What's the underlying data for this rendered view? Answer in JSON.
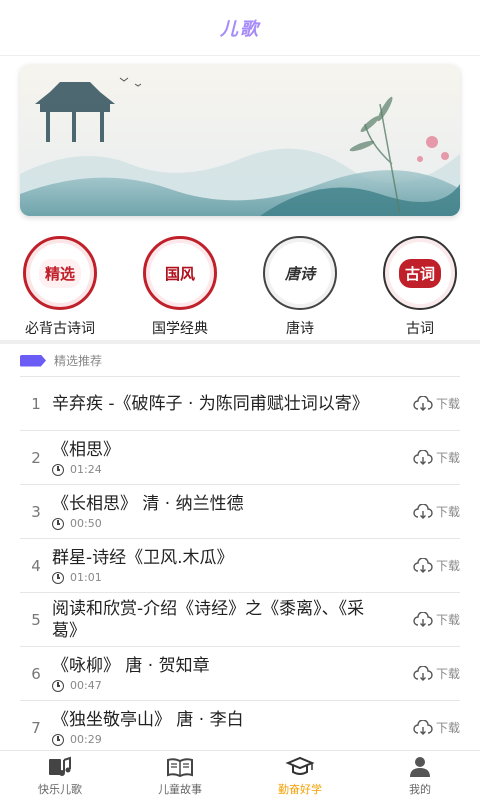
{
  "header": {
    "title": "儿歌"
  },
  "categories": [
    {
      "badge": "精选",
      "label": "必背古诗词"
    },
    {
      "badge": "国风",
      "label": "国学经典"
    },
    {
      "badge": "唐诗",
      "label": "唐诗"
    },
    {
      "badge": "古词",
      "label": "古词"
    }
  ],
  "section": {
    "title": "精选推荐"
  },
  "items": [
    {
      "num": "1",
      "name": " 辛弃疾 -《破阵子 · 为陈同甫赋壮词以寄》",
      "duration": "",
      "download": "下载"
    },
    {
      "num": "2",
      "name": "《相思》",
      "duration": "01:24",
      "download": "下载"
    },
    {
      "num": "3",
      "name": "《长相思》 清 · 纳兰性德",
      "duration": "00:50",
      "download": "下载"
    },
    {
      "num": "4",
      "name": "群星-诗经《卫风.木瓜》",
      "duration": "01:01",
      "download": "下载"
    },
    {
      "num": "5",
      "name": "阅读和欣赏-介绍《诗经》之《黍离》、《采葛》",
      "duration": "",
      "download": "下载"
    },
    {
      "num": "6",
      "name": "《咏柳》 唐 · 贺知章",
      "duration": "00:47",
      "download": "下载"
    },
    {
      "num": "7",
      "name": "《独坐敬亭山》 唐 · 李白",
      "duration": "00:29",
      "download": "下载"
    }
  ],
  "tabs": [
    {
      "label": "快乐儿歌",
      "icon": "music-book-icon",
      "active": false
    },
    {
      "label": "儿童故事",
      "icon": "book-icon",
      "active": false
    },
    {
      "label": "勤奋好学",
      "icon": "graduation-cap-icon",
      "active": true
    },
    {
      "label": "我的",
      "icon": "user-icon",
      "active": false
    }
  ],
  "colors": {
    "accent": "#f5a000",
    "title": "#a78bfa",
    "section_flag": "#6a5cf5"
  }
}
